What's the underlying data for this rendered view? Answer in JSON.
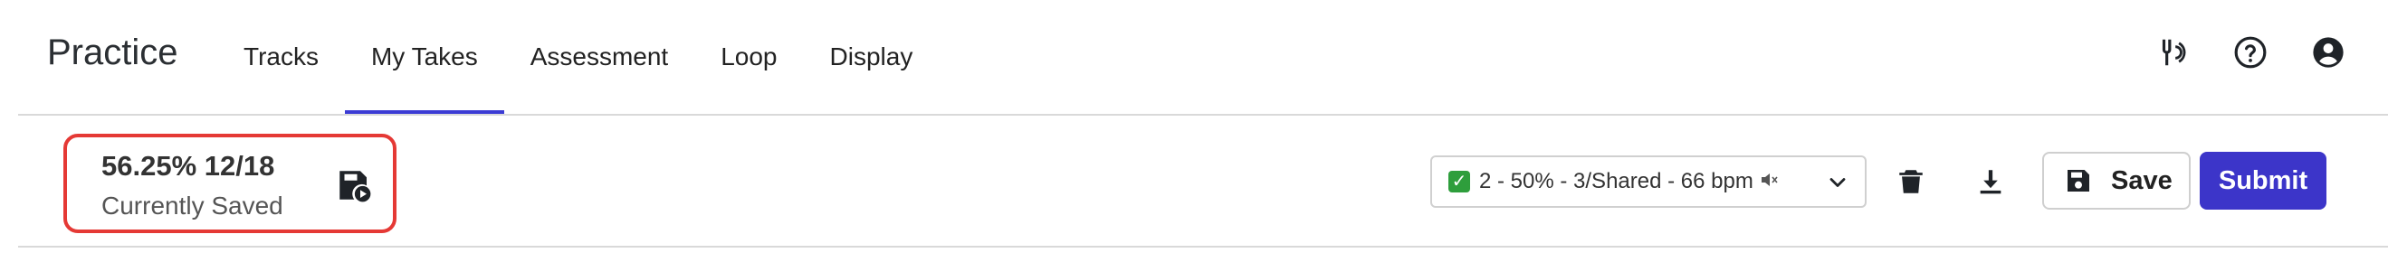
{
  "app": {
    "title": "Practice"
  },
  "nav": {
    "tabs": [
      {
        "label": "Tracks"
      },
      {
        "label": "My Takes"
      },
      {
        "label": "Assessment"
      },
      {
        "label": "Loop"
      },
      {
        "label": "Display"
      }
    ],
    "active_tab": "My Takes"
  },
  "header_icons": [
    "tuning-fork-icon",
    "help-icon",
    "account-icon"
  ],
  "take": {
    "score": "56.25% 12/18",
    "status": "Currently Saved",
    "selected_take": "2 - 50% - 3/Shared - 66 bpm"
  },
  "actions": {
    "save_label": "Save",
    "submit_label": "Submit"
  },
  "colors": {
    "accent": "#3c35c9",
    "highlight_border": "#e53935",
    "check_green": "#2e9e3c"
  }
}
